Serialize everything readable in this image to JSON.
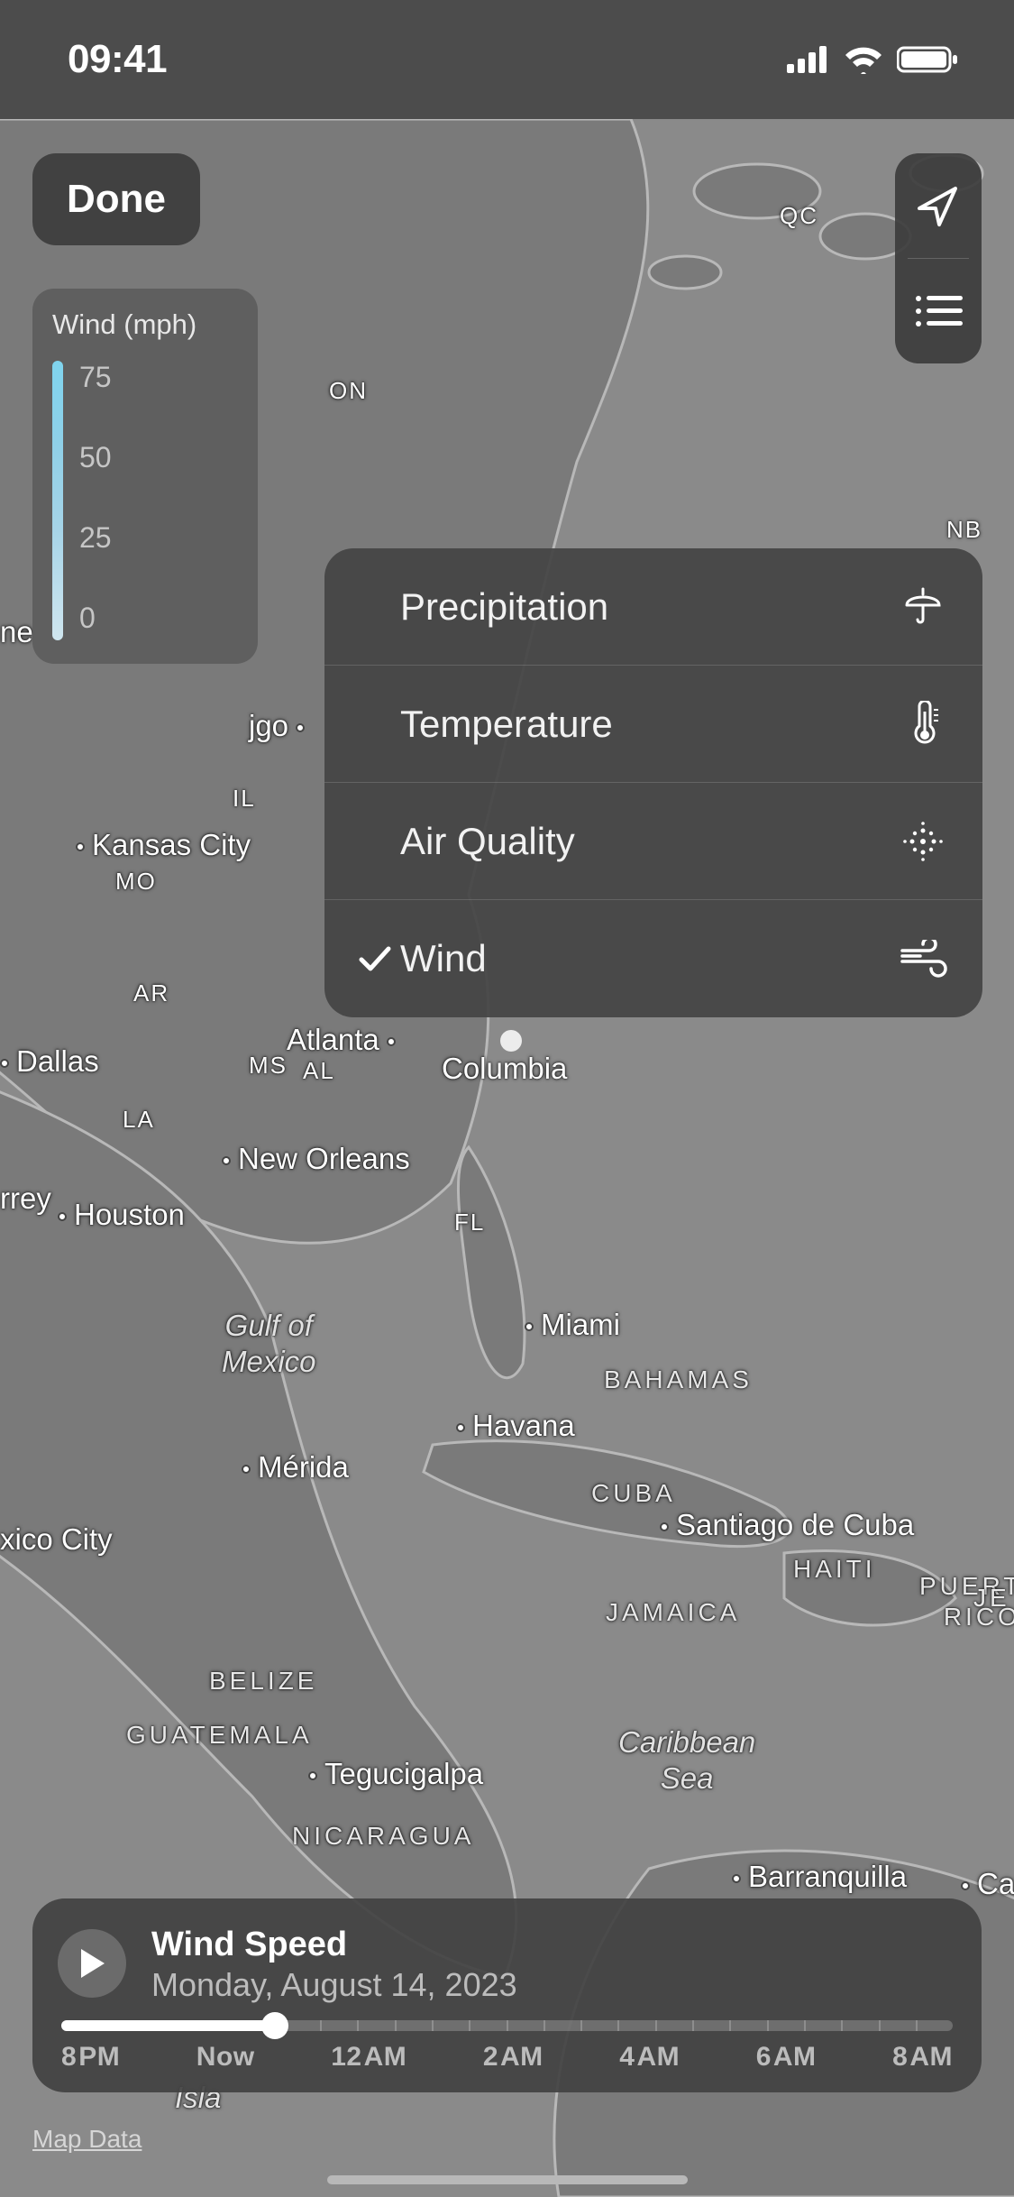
{
  "status": {
    "time": "09:41"
  },
  "done_label": "Done",
  "legend": {
    "title": "Wind (mph)",
    "ticks": [
      "75",
      "50",
      "25",
      "0"
    ]
  },
  "layers": {
    "items": [
      {
        "label": "Precipitation",
        "selected": false,
        "icon": "umbrella-icon"
      },
      {
        "label": "Temperature",
        "selected": false,
        "icon": "thermometer-icon"
      },
      {
        "label": "Air Quality",
        "selected": false,
        "icon": "particles-icon"
      },
      {
        "label": "Wind",
        "selected": true,
        "icon": "wind-icon"
      }
    ]
  },
  "timeline": {
    "title": "Wind Speed",
    "subtitle": "Monday, August 14, 2023",
    "labels": [
      {
        "text": "8",
        "suffix": "PM",
        "now": false
      },
      {
        "text": "Now",
        "suffix": "",
        "now": true
      },
      {
        "text": "12",
        "suffix": "AM",
        "now": false
      },
      {
        "text": "2",
        "suffix": "AM",
        "now": false
      },
      {
        "text": "4",
        "suffix": "AM",
        "now": false
      },
      {
        "text": "6",
        "suffix": "AM",
        "now": false
      },
      {
        "text": "8",
        "suffix": "AM",
        "now": false
      }
    ]
  },
  "map_data_label": "Map Data",
  "map_labels": {
    "qc": "QC",
    "on": "ON",
    "nb": "NB",
    "ne": "ne",
    "jgo": "jgo",
    "il": "IL",
    "kansas_city": "Kansas City",
    "mo": "MO",
    "ar": "AR",
    "dallas": "Dallas",
    "ms": "MS",
    "atlanta": "Atlanta",
    "al": "AL",
    "columbia": "Columbia",
    "la": "LA",
    "new_orleans": "New Orleans",
    "rrey": "rrey",
    "houston": "Houston",
    "fl": "FL",
    "gulf": "Gulf of\nMexico",
    "miami": "Miami",
    "bahamas": "BAHAMAS",
    "havana": "Havana",
    "cuba": "CUBA",
    "merida": "Mérida",
    "santiago": "Santiago de Cuba",
    "xico": "xico City",
    "haiti": "HAITI",
    "jamaica": "JAMAICA",
    "pr": "PUERTO\nRICO",
    "belize": "BELIZE",
    "guatemala": "GUATEMALA",
    "tegu": "Tegucigalpa",
    "caribbean": "Caribbean\nSea",
    "nicaragua": "NICARAGUA",
    "barranquilla": "Barranquilla",
    "cara": "Cara",
    "isla": "Isla",
    "je": "JE"
  }
}
